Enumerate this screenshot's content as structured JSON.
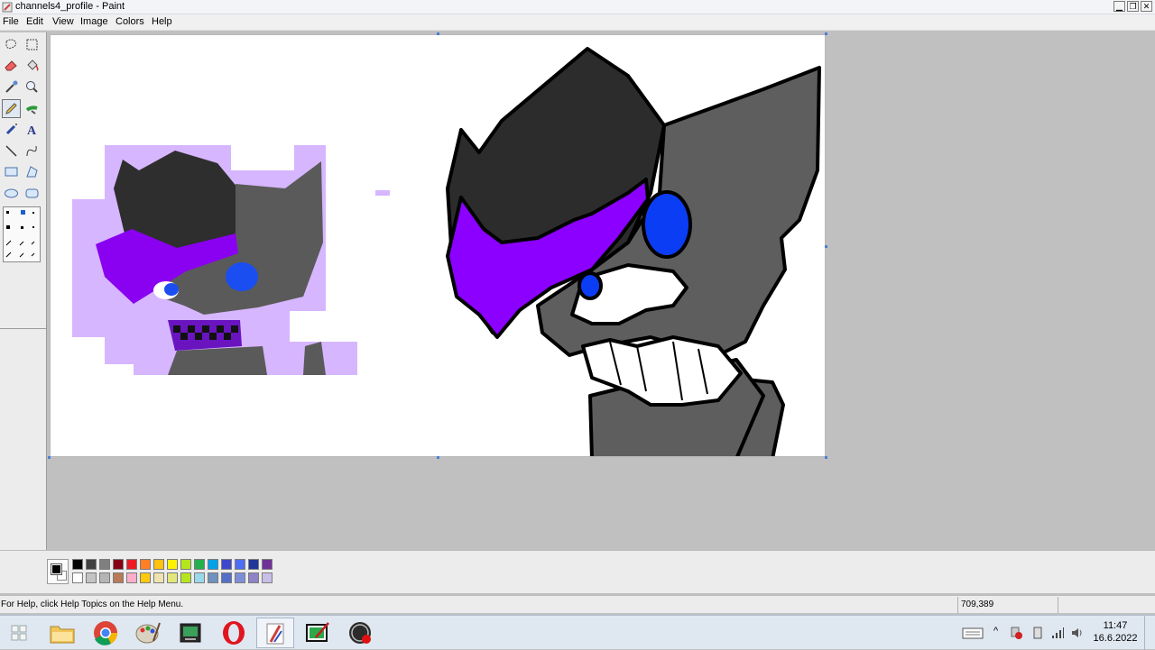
{
  "window": {
    "title": "channels4_profile - Paint",
    "minimize_icon": "minimize-icon",
    "restore_icon": "restore-icon",
    "close_icon": "close-icon"
  },
  "menu": [
    "File",
    "Edit",
    "View",
    "Image",
    "Colors",
    "Help"
  ],
  "tools": [
    {
      "name": "free-form-select-icon"
    },
    {
      "name": "select-icon"
    },
    {
      "name": "eraser-icon"
    },
    {
      "name": "fill-icon"
    },
    {
      "name": "pick-color-icon"
    },
    {
      "name": "magnifier-icon"
    },
    {
      "name": "pencil-icon",
      "selected": true
    },
    {
      "name": "brush-icon"
    },
    {
      "name": "airbrush-icon"
    },
    {
      "name": "text-icon"
    },
    {
      "name": "line-icon"
    },
    {
      "name": "curve-icon"
    },
    {
      "name": "rectangle-icon"
    },
    {
      "name": "polygon-icon"
    },
    {
      "name": "ellipse-icon"
    },
    {
      "name": "rounded-rectangle-icon"
    }
  ],
  "colors": {
    "foreground": "#000000",
    "background": "#ffffff",
    "palette_top": [
      "#000000",
      "#404040",
      "#7f7f7f",
      "#880015",
      "#ed1c24",
      "#ff7f27",
      "#ffc20e",
      "#fff200",
      "#b5e61d",
      "#22b14c",
      "#00a2e8",
      "#3f48cc",
      "#4d6df3",
      "#1e3799",
      "#6f3198"
    ],
    "palette_bottom": [
      "#ffffff",
      "#c3c3c3",
      "#b4b4b4",
      "#b97a57",
      "#ffaec9",
      "#ffc90e",
      "#efe4b0",
      "#e0e67a",
      "#b5e61d",
      "#99d9ea",
      "#7092be",
      "#546fc8",
      "#7c8fd8",
      "#8f82c7",
      "#c8bfe7"
    ]
  },
  "status": {
    "help_text": "For Help, click Help Topics on the Help Menu.",
    "coordinates": "709,389"
  },
  "taskbar": {
    "apps": [
      "start-button",
      "file-explorer-icon",
      "chrome-icon",
      "paint-shop-icon",
      "media-player-icon",
      "opera-icon",
      "paint-icon",
      "tablet-app-icon",
      "obs-icon"
    ],
    "time": "11:47",
    "date": "16.6.2022"
  }
}
